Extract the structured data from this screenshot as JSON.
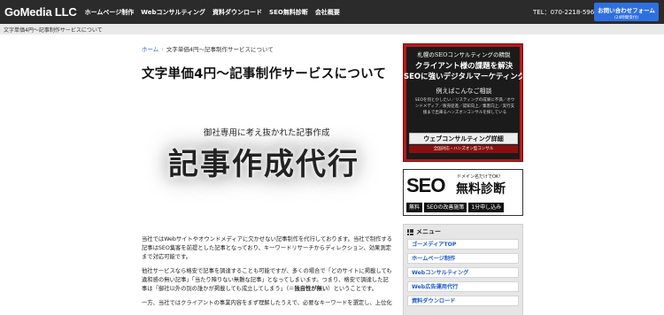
{
  "header": {
    "logo": "GoMedia LLC",
    "nav": [
      "ホームページ制作",
      "Webコンサルティング",
      "資料ダウンロード",
      "SEO無料診断",
      "会社概要"
    ],
    "tel": "TEL：070-2218-5962",
    "contact_label": "お問い合わせフォーム",
    "contact_sub": "(24時間受付)"
  },
  "top_crumb": "文字単価4円〜記事制作サービスについて",
  "breadcrumb": {
    "home": "ホーム",
    "sep": "›",
    "current": "文字単価4円〜記事制作サービスについて"
  },
  "page_title": "文字単価4円〜記事制作サービスについて",
  "hero": {
    "subtitle": "御社専用に考え抜かれた記事作成",
    "title": "記事作成代行"
  },
  "body": {
    "p1": "当社ではWebサイトやオウンドメディアに欠かせない記事制作を代行しております。当社で制作する記事はSEO集客を前提とした記事となっており、キーワードリサーチからディレクション、効果測定まで対応可能です。",
    "p2_before": "他社サービスなら格安で記事を調達することも可能ですが、多くの場合で「どのサイトに掲載しても違和感の無い記事」「当たり障りない無難な記事」となってしまいます。つまり、格安で調達した記事は「御社以外の別の誰かが掲載しても成立してしまう」（＝",
    "p2_bold": "独自性が無い",
    "p2_after": "）ということです。",
    "p3": "一方、当社ではクライアントの事業内容をまず理解したうえで、必要なキーワードを選定し、上位化"
  },
  "ad_consulting": {
    "line1": "札幌のSEOコンサルティングの精鋭",
    "line2": "クライアント様の課題を解決",
    "line3": "SEOに強いデジタルマーケティング",
    "line4": "例えばこんなご相談",
    "desc": "SEOを何とかしたい／リスティングの成果に不満／オウンドメディア／販売促進／認知向上／集客向上／実行支援まで出来るハンズオンコンサルを探している",
    "cta": "ウェブコンサルティング詳細",
    "cta_sub": "全国対応・ハンズオン型コンサル"
  },
  "ad_seo": {
    "seo": "SEO",
    "small": "ドメイン名だけでOK!",
    "title": "無料診断",
    "tags": [
      "無料",
      "SEOの改善施策",
      "1分申し込み"
    ]
  },
  "menu": {
    "title": "メニュー",
    "items": [
      "ゴーメディアTOP",
      "ホームページ制作",
      "Webコンサルティング",
      "Web広告運用代行",
      "資料ダウンロード"
    ]
  }
}
